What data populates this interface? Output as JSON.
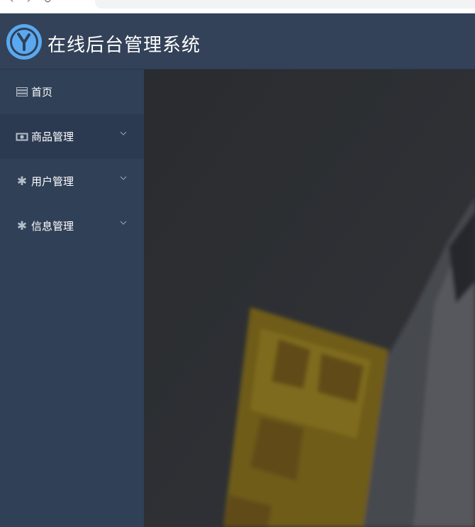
{
  "header": {
    "title": "在线后台管理系统"
  },
  "sidebar": {
    "items": [
      {
        "label": "首页",
        "icon": "server-icon",
        "has_submenu": false,
        "active": false
      },
      {
        "label": "商品管理",
        "icon": "money-icon",
        "has_submenu": true,
        "active": true
      },
      {
        "label": "用户管理",
        "icon": "asterisk-icon",
        "has_submenu": true,
        "active": false
      },
      {
        "label": "信息管理",
        "icon": "asterisk-icon",
        "has_submenu": true,
        "active": false
      }
    ]
  },
  "colors": {
    "header_bg": "#334259",
    "sidebar_bg": "#304057",
    "sidebar_active_bg": "#2b3a51",
    "logo_blue": "#5aa9f0",
    "content_bg": "#34373c"
  }
}
